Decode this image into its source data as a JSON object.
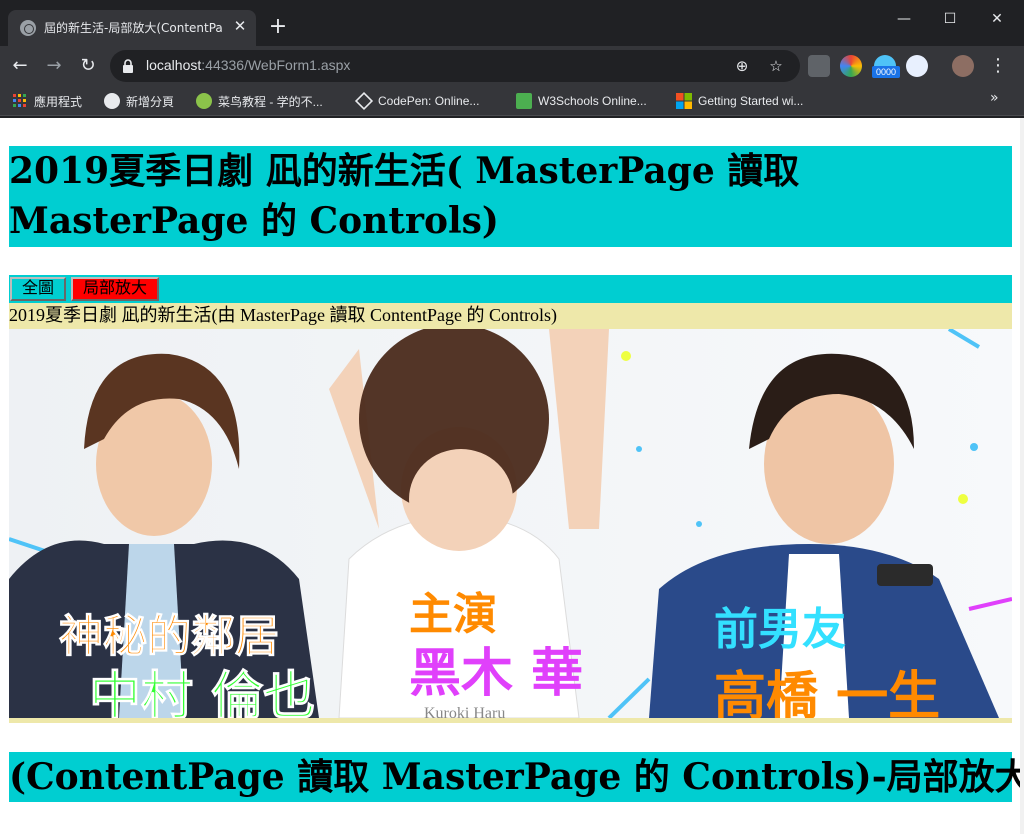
{
  "browser": {
    "tab_title": "屆的新生活-局部放大(ContentPa",
    "url_host": "localhost",
    "url_path": ":44336/WebForm1.aspx",
    "extension_badge": "0000",
    "bookmarks": [
      {
        "label": "應用程式",
        "icon": "apps-grid-icon"
      },
      {
        "label": "新增分頁",
        "icon": "globe-icon"
      },
      {
        "label": "菜鸟教程 - 学的不...",
        "icon": "runoob-icon"
      },
      {
        "label": "CodePen: Online...",
        "icon": "codepen-icon"
      },
      {
        "label": "W3Schools Online...",
        "icon": "w3schools-icon"
      },
      {
        "label": "Getting Started wi...",
        "icon": "microsoft-icon"
      }
    ],
    "more_bookmarks": "»"
  },
  "page": {
    "master_title": "2019夏季日劇 凪的新生活( MasterPage 讀取 MasterPage 的 Controls)",
    "btn_full": "全圖",
    "btn_zoom": "局部放大",
    "caption": "2019夏季日劇 凪的新生活(由 MasterPage 讀取 ContentPage 的 Controls)",
    "poster": {
      "left_role": "神秘的鄰居",
      "left_name": "中村 倫也",
      "center_role": "主演",
      "center_name": "黑木 華",
      "center_roman": "Kuroki Haru",
      "right_role": "前男友",
      "right_name": "高橋 一生"
    },
    "content_title": "(ContentPage 讀取 MasterPage 的 Controls)-局部放大"
  },
  "colors": {
    "accent_cyan": "#00ced1",
    "caption_bg": "#eee8aa",
    "zoom_button": "#ff0000"
  }
}
